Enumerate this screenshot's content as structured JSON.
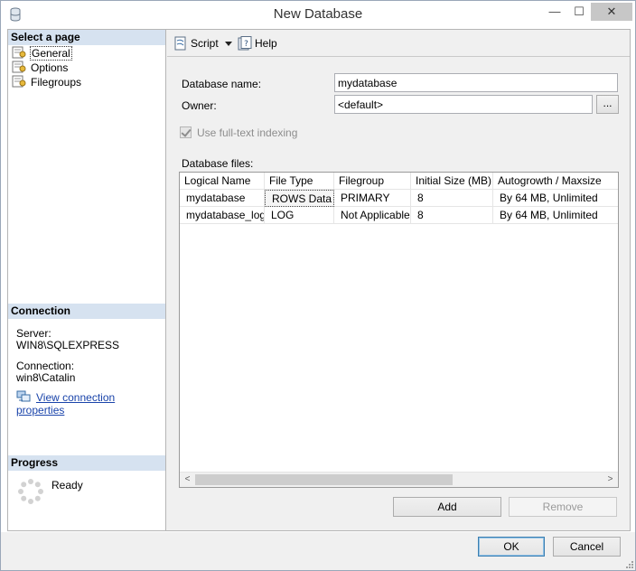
{
  "window": {
    "title": "New Database"
  },
  "title_buttons": {
    "minimize": "—",
    "maximize": "☐",
    "close": "✕"
  },
  "left": {
    "select_page_header": "Select a page",
    "pages": [
      {
        "label": "General",
        "icon": "page-settings-icon",
        "selected": true
      },
      {
        "label": "Options",
        "icon": "page-settings-icon",
        "selected": false
      },
      {
        "label": "Filegroups",
        "icon": "page-settings-icon",
        "selected": false
      }
    ],
    "connection_header": "Connection",
    "server_label": "Server:",
    "server_value": "WIN8\\SQLEXPRESS",
    "connection_label": "Connection:",
    "connection_value": "win8\\Catalin",
    "view_connection_link": "View connection properties",
    "progress_header": "Progress",
    "progress_status": "Ready"
  },
  "toolbar": {
    "script_label": "Script",
    "help_label": "Help"
  },
  "form": {
    "db_name_label": "Database name:",
    "db_name_value": "mydatabase",
    "owner_label": "Owner:",
    "owner_value": "<default>",
    "browse_label": "...",
    "fulltext_label": "Use full-text indexing",
    "db_files_label": "Database files:"
  },
  "grid": {
    "columns": [
      "Logical Name",
      "File Type",
      "Filegroup",
      "Initial Size (MB)",
      "Autogrowth / Maxsize"
    ],
    "rows": [
      [
        "mydatabase",
        "ROWS Data",
        "PRIMARY",
        "8",
        "By 64 MB, Unlimited"
      ],
      [
        "mydatabase_log",
        "LOG",
        "Not Applicable",
        "8",
        "By 64 MB, Unlimited"
      ]
    ],
    "scroll_left": "<",
    "scroll_right": ">"
  },
  "buttons": {
    "add": "Add",
    "remove": "Remove",
    "ok": "OK",
    "cancel": "Cancel"
  }
}
